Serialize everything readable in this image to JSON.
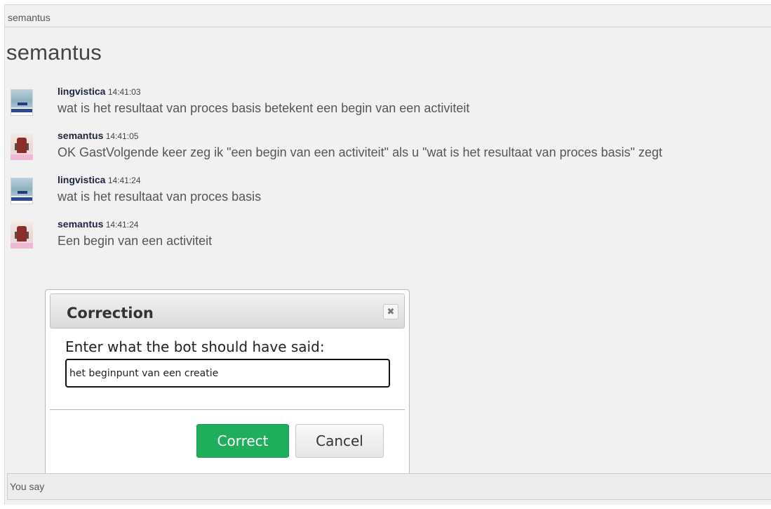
{
  "topbar": {
    "title": "semantus"
  },
  "page": {
    "title": "semantus"
  },
  "messages": [
    {
      "user": "lingvistica",
      "time": "14:41:03",
      "text": "wat is het resultaat van proces basis betekent een begin van een activiteit",
      "avatar": "lingvistica-avatar"
    },
    {
      "user": "semantus",
      "time": "14:41:05",
      "text": "OK GastVolgende keer zeg ik \"een begin van een activiteit\" als u \"wat is het resultaat van proces basis\" zegt",
      "avatar": "semantus-avatar"
    },
    {
      "user": "lingvistica",
      "time": "14:41:24",
      "text": "wat is het resultaat van proces basis",
      "avatar": "lingvistica-avatar"
    },
    {
      "user": "semantus",
      "time": "14:41:24",
      "text": "Een begin van een activiteit",
      "avatar": "semantus-avatar"
    }
  ],
  "dialog": {
    "title": "Correction",
    "close_icon": "close-icon",
    "prompt": "Enter what the bot should have said:",
    "input_value": "het beginpunt van een creatie",
    "correct_label": "Correct",
    "cancel_label": "Cancel",
    "correct_color": "#1fae5b"
  },
  "chat_input": {
    "placeholder": "You say"
  }
}
